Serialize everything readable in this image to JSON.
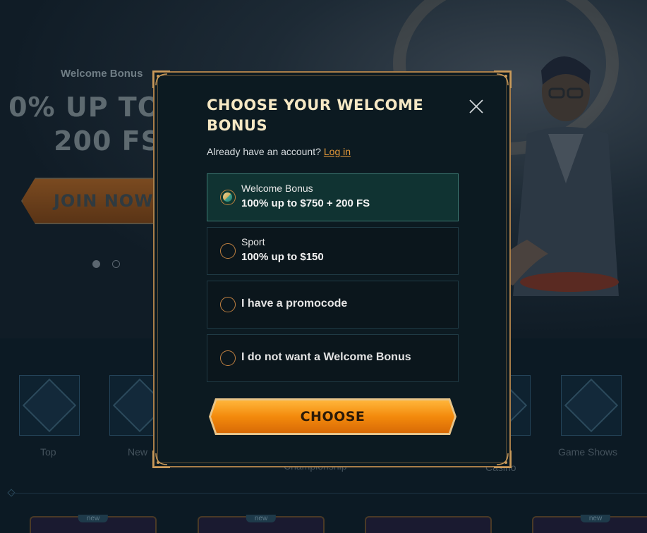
{
  "background": {
    "hero_label": "Welcome Bonus",
    "hero_title_line1": "0% UP TO",
    "hero_title_line2": "200 FS",
    "join_label": "JOIN NOW",
    "categories": [
      {
        "label": "Top"
      },
      {
        "label": "New"
      },
      {
        "label": "Championship"
      },
      {
        "label": "Live Casino"
      },
      {
        "label": "Game Shows"
      }
    ],
    "tile_badge": "new"
  },
  "modal": {
    "title": "CHOOSE YOUR WELCOME BONUS",
    "account_prompt": "Already have an account?",
    "login_link": "Log in",
    "options": [
      {
        "subtitle": "Welcome Bonus",
        "title": "100% up to $750 + 200 FS",
        "selected": true
      },
      {
        "subtitle": "Sport",
        "title": "100% up to $150",
        "selected": false
      },
      {
        "title": "I have a promocode",
        "selected": false
      },
      {
        "title": "I do not want a Welcome Bonus",
        "selected": false
      }
    ],
    "choose_label": "CHOOSE"
  },
  "colors": {
    "accent_gold": "#a97e49",
    "button_orange": "#f08a10",
    "selected_teal": "#103332",
    "link_orange": "#e69a3a"
  },
  "icons": {
    "close": "close-icon",
    "radio": "radio-icon",
    "corner": "ornament-corner-icon"
  }
}
